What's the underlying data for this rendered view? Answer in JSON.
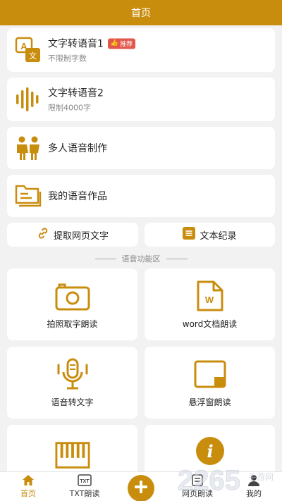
{
  "header": {
    "title": "首页"
  },
  "rows": [
    {
      "title": "文字转语音1",
      "badge": "推荐",
      "subtitle": "不限制字数",
      "icon": "text-to-speech-icon"
    },
    {
      "title": "文字转语音2",
      "subtitle": "限制4000字",
      "icon": "soundwave-icon"
    },
    {
      "title": "多人语音制作",
      "icon": "people-icon"
    },
    {
      "title": "我的语音作品",
      "icon": "folder-icon"
    }
  ],
  "quick": {
    "extract": "提取网页文字",
    "record": "文本纪录"
  },
  "section_title": "语音功能区",
  "grid": [
    {
      "label": "拍照取字朗读",
      "icon": "camera-icon"
    },
    {
      "label": "word文档朗读",
      "icon": "word-document-icon"
    },
    {
      "label": "语音转文字",
      "icon": "microphone-icon"
    },
    {
      "label": "悬浮窗朗读",
      "icon": "floating-window-icon"
    },
    {
      "label": "",
      "icon": "piano-icon"
    },
    {
      "label": "",
      "icon": "info-icon"
    }
  ],
  "tabbar": {
    "home": "首页",
    "txt": "TXT朗读",
    "txt_icon_text": "TXT",
    "web": "网页朗读",
    "mine": "我的"
  },
  "watermark": {
    "brand": "2265",
    "sub": "手游网"
  },
  "colors": {
    "accent": "#c98d0e",
    "badge": "#e2574c"
  }
}
